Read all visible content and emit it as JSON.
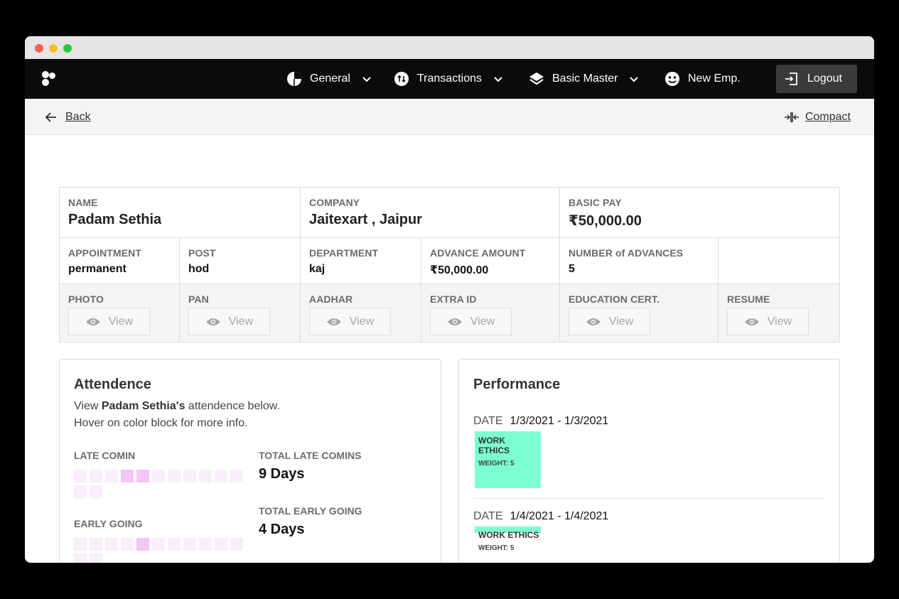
{
  "nav": {
    "items": [
      {
        "label": "General",
        "icon": "pie-chart-icon"
      },
      {
        "label": "Transactions",
        "icon": "transfer-icon"
      },
      {
        "label": "Basic Master",
        "icon": "layers-icon"
      },
      {
        "label": "New Emp.",
        "icon": "user-face-icon"
      }
    ],
    "logout_label": "Logout"
  },
  "subbar": {
    "back_label": "Back",
    "compact_label": "Compact"
  },
  "employee": {
    "name_label": "NAME",
    "name": "Padam Sethia",
    "company_label": "COMPANY",
    "company": "Jaitexart , Jaipur",
    "basic_pay_label": "BASIC PAY",
    "basic_pay": "₹50,000.00",
    "appointment_label": "APPOINTMENT",
    "appointment": "permanent",
    "post_label": "POST",
    "post": "hod",
    "department_label": "DEPARTMENT",
    "department": "kaj",
    "advance_amount_label": "ADVANCE AMOUNT",
    "advance_amount": "₹50,000.00",
    "num_advances_label": "NUMBER of ADVANCES",
    "num_advances": "5"
  },
  "documents": {
    "view_label": "View",
    "items": [
      {
        "label": "PHOTO"
      },
      {
        "label": "PAN"
      },
      {
        "label": "AADHAR"
      },
      {
        "label": "EXTRA ID"
      },
      {
        "label": "EDUCATION CERT."
      },
      {
        "label": "RESUME"
      }
    ]
  },
  "attendance": {
    "title": "Attendence",
    "desc_prefix": "View ",
    "desc_name": "Padam Sethia's",
    "desc_suffix": " attendence below.",
    "desc_line2": "Hover on color block for more info.",
    "late_label": "LATE COMIN",
    "total_late_label": "TOTAL LATE COMINS",
    "total_late_value": "9 Days",
    "early_label": "EARLY GOING",
    "total_early_label": "TOTAL EARLY GOING",
    "total_early_value": "4 Days",
    "late_blocks": [
      0,
      0,
      0,
      1,
      1,
      0,
      0,
      0,
      0,
      0,
      0,
      0,
      0
    ],
    "early_blocks": [
      0,
      0,
      0,
      0,
      1,
      0,
      0,
      0,
      0,
      0,
      0,
      0,
      0
    ]
  },
  "performance": {
    "title": "Performance",
    "date_label": "DATE",
    "entries": [
      {
        "date": "1/3/2021 - 1/3/2021",
        "metric": "WORK ETHICS",
        "weight": "WEIGHT: 5"
      },
      {
        "date": "1/4/2021 - 1/4/2021",
        "metric": "WORK ETHICS",
        "weight": "WEIGHT: 5"
      }
    ]
  },
  "colors": {
    "navbar": "#0b0b0b",
    "logout_bg": "#3b3b3b",
    "performance_block": "#7cffd4",
    "attendance_block": "#faeefc",
    "attendance_block_active": "#f4c6f7"
  }
}
